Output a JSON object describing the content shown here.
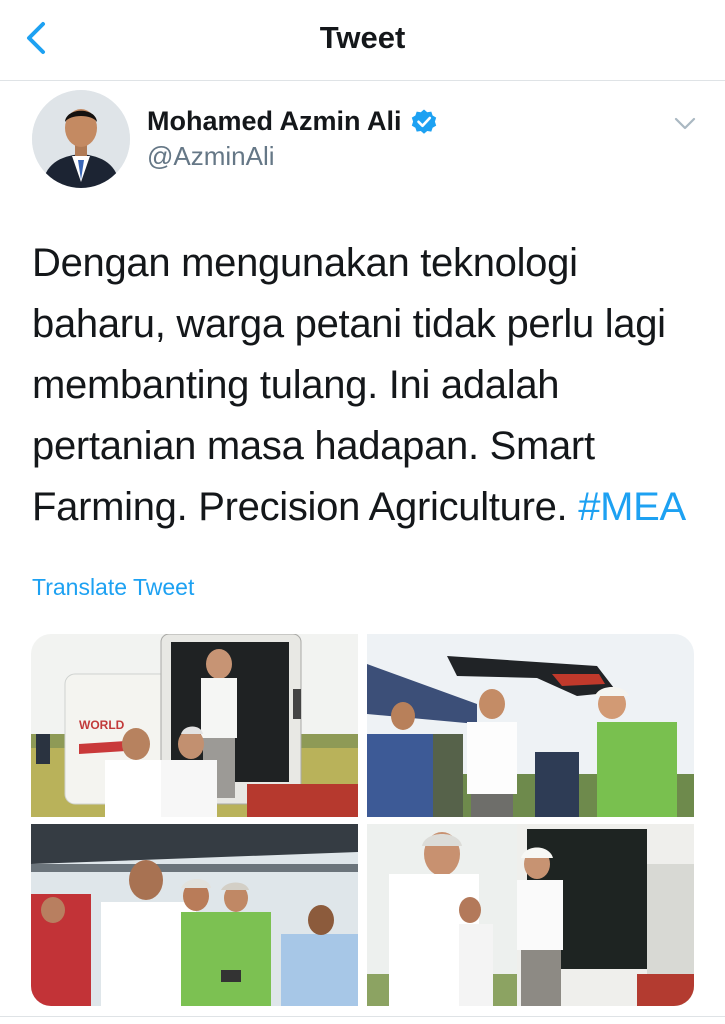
{
  "header": {
    "title": "Tweet",
    "back_icon": "chevron-left-icon"
  },
  "colors": {
    "accent": "#1da1f2",
    "text": "#14171a",
    "muted": "#657786",
    "divider": "#dfe3e6"
  },
  "author": {
    "name": "Mohamed Azmin Ali",
    "handle": "@AzminAli",
    "verified": true,
    "verified_icon": "verified-badge-icon",
    "more_icon": "chevron-down-icon"
  },
  "tweet": {
    "text": "Dengan mengunakan teknologi baharu, warga petani tidak perlu lagi membanting tulang. Ini adalah pertanian masa hadapan. Smart Farming. Precision Agriculture.",
    "hashtag": "#MEA",
    "translate_label": "Translate Tweet"
  },
  "media": [
    {
      "name": "photo-combine-harvester-cabin"
    },
    {
      "name": "photo-drone-handover"
    },
    {
      "name": "photo-crowd-with-remote"
    },
    {
      "name": "photo-handshake-at-harvester"
    }
  ]
}
